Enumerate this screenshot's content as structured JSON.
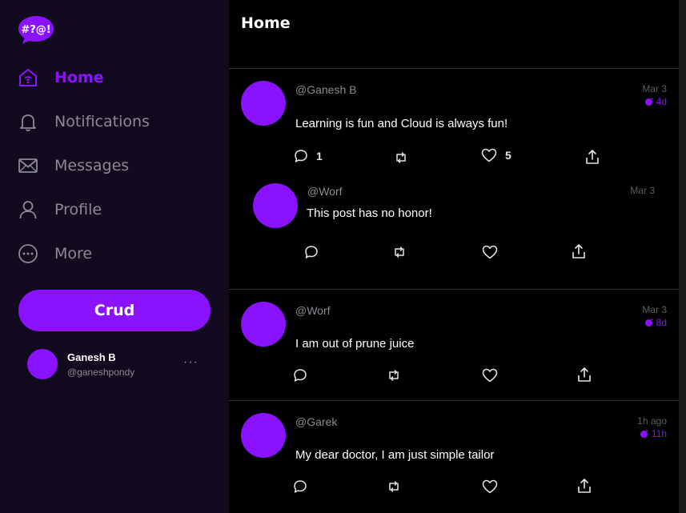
{
  "logo": {
    "text": "#?@!",
    "color": "#8a12ff"
  },
  "sidebar": {
    "items": [
      {
        "label": "Home",
        "icon": "home-icon",
        "active": true
      },
      {
        "label": "Notifications",
        "icon": "bell-icon",
        "active": false
      },
      {
        "label": "Messages",
        "icon": "envelope-icon",
        "active": false
      },
      {
        "label": "Profile",
        "icon": "user-icon",
        "active": false
      },
      {
        "label": "More",
        "icon": "more-circle-icon",
        "active": false
      }
    ],
    "crud_label": "Crud",
    "user": {
      "name": "Ganesh B",
      "handle": "@ganeshpondy",
      "more": "···"
    }
  },
  "header": {
    "title": "Home"
  },
  "colors": {
    "accent": "#8a12ff",
    "sidebar_bg": "#120a1f",
    "muted": "#8c8a93"
  },
  "posts": [
    {
      "handle": "@Ganesh B",
      "text": "Learning is fun and Cloud is always fun!",
      "date": "Mar 3",
      "age": "4d",
      "replies": "1",
      "likes": "5",
      "reply": {
        "handle": "@Worf",
        "text": "This post has no honor!",
        "date": "Mar 3"
      }
    },
    {
      "handle": "@Worf",
      "text": "I am out of prune juice",
      "date": "Mar 3",
      "age": "8d"
    },
    {
      "handle": "@Garek",
      "text": "My dear doctor, I am just simple tailor",
      "date": "1h ago",
      "age": "11h"
    }
  ]
}
